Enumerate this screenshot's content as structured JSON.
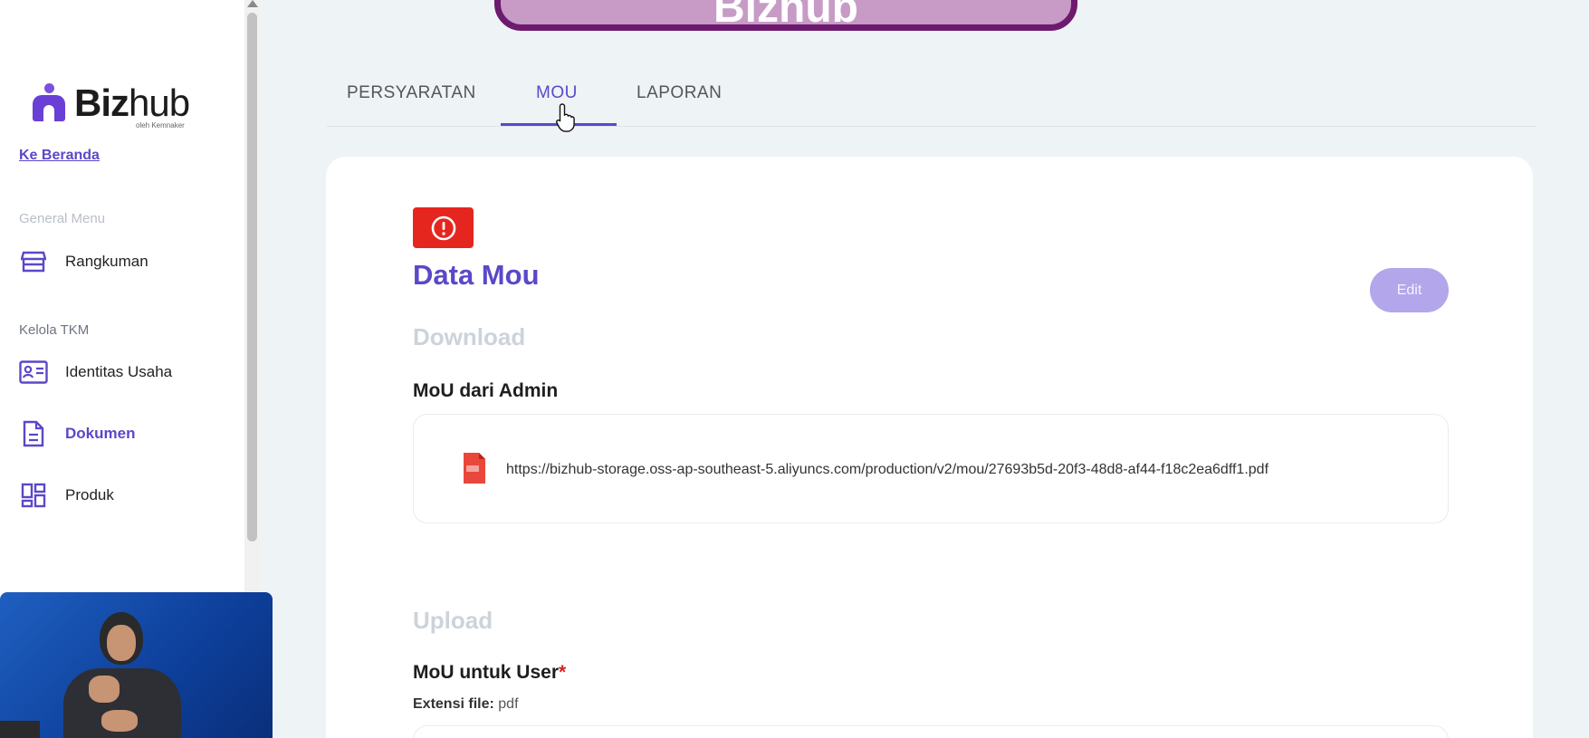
{
  "banner": {
    "text": "Bizhub"
  },
  "sidebar": {
    "logo_text_bold": "Biz",
    "logo_text_light": "hub",
    "logo_sub": "oleh Kemnaker",
    "home_link": "Ke Beranda",
    "section_general": "General Menu",
    "section_kelola": "Kelola TKM",
    "items": [
      {
        "label": "Rangkuman",
        "icon": "store-icon"
      },
      {
        "label": "Identitas Usaha",
        "icon": "id-card-icon"
      },
      {
        "label": "Dokumen",
        "icon": "document-icon",
        "active": true
      },
      {
        "label": "Produk",
        "icon": "grid-icon"
      }
    ]
  },
  "tabs": [
    {
      "label": "PERSYARATAN"
    },
    {
      "label": "MOU",
      "active": true
    },
    {
      "label": "LAPORAN"
    }
  ],
  "card": {
    "title": "Data Mou",
    "edit_label": "Edit",
    "download_label": "Download",
    "mou_admin_label": "MoU dari Admin",
    "file_url": "https://bizhub-storage.oss-ap-southeast-5.aliyuncs.com/production/v2/mou/27693b5d-20f3-48d8-af44-f18c2ea6dff1.pdf",
    "upload_label": "Upload",
    "mou_user_label": "MoU untuk User",
    "required_mark": "*",
    "ext_label": "Extensi file:",
    "ext_value": "pdf"
  },
  "colors": {
    "accent": "#5a48c9",
    "alert": "#e5261f",
    "edit_button": "#b3a6ea"
  }
}
